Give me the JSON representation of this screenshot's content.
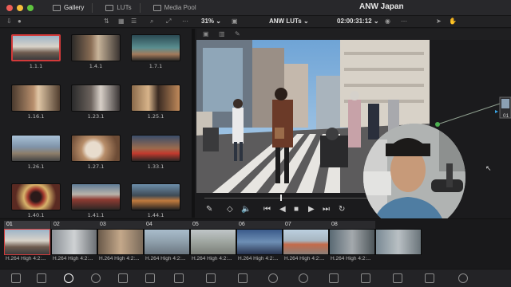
{
  "window": {
    "project_title": "ANW Japan"
  },
  "page_tabs": [
    {
      "label": "Gallery",
      "active": true
    },
    {
      "label": "LUTs",
      "active": false
    },
    {
      "label": "Media Pool",
      "active": false
    }
  ],
  "viewer_toolbar": {
    "zoom": "31%",
    "lut_menu": "ANW LUTs",
    "timecode": "02:00:31:12"
  },
  "gallery": {
    "stills": [
      "1.1.1",
      "1.4.1",
      "1.7.1",
      "1.16.1",
      "1.23.1",
      "1.25.1",
      "1.26.1",
      "1.27.1",
      "1.33.1",
      "1.40.1",
      "1.41.1",
      "1.44.1"
    ],
    "selected": "1.1.1"
  },
  "nodes": {
    "node_label": "01"
  },
  "timeline": {
    "clips": [
      {
        "num": "01",
        "codec": "H.264 High 4:2:..."
      },
      {
        "num": "02",
        "codec": "H.264 High 4:2:..."
      },
      {
        "num": "03",
        "codec": "H.264 High 4:2:..."
      },
      {
        "num": "04",
        "codec": "H.264 High 4:2:..."
      },
      {
        "num": "05",
        "codec": "H.264 High 4:2:..."
      },
      {
        "num": "06",
        "codec": "H.264 High 4:2:..."
      },
      {
        "num": "07",
        "codec": "H.264 High 4:2:..."
      },
      {
        "num": "08",
        "codec": "H.264 High 4:2:..."
      }
    ]
  },
  "colors": {
    "selection": "#d33a3a",
    "background": "#1b1b1d"
  }
}
